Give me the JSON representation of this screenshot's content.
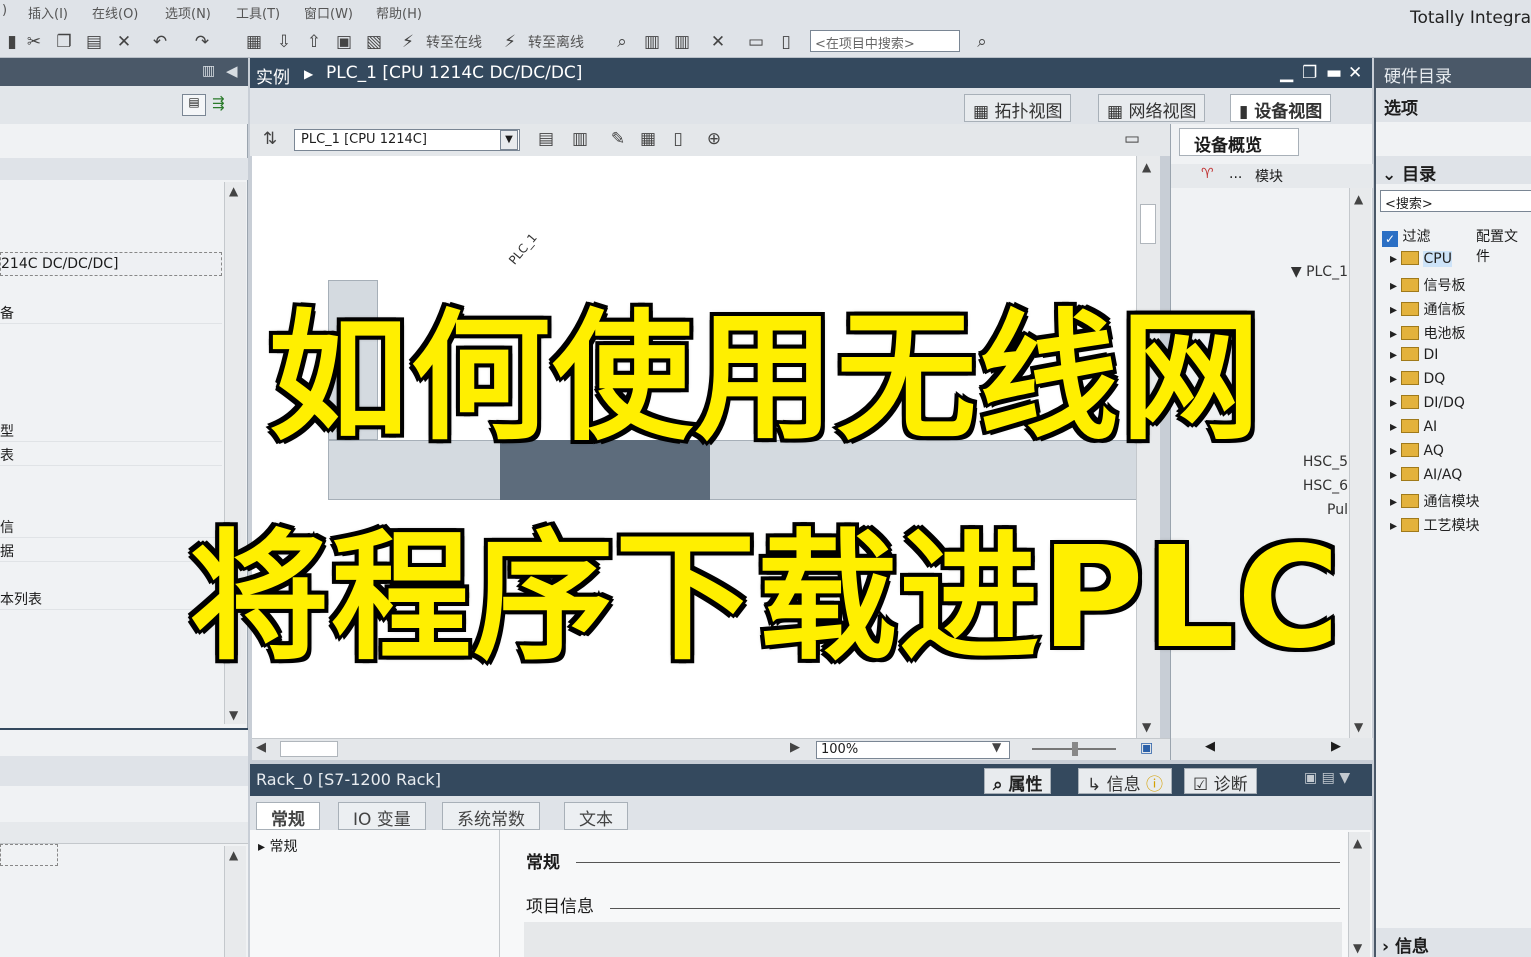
{
  "app": {
    "brand": "Totally Integra"
  },
  "menu": {
    "items": [
      ") ",
      "插入(I)",
      "在线(O)",
      "选项(N)",
      "工具(T)",
      "窗口(W)",
      "帮助(H)"
    ]
  },
  "toolbar": {
    "go_online": "转至在线",
    "go_offline": "转至离线",
    "search_placeholder": "<在项目中搜索>"
  },
  "left_panel": {
    "rows": [
      "214C DC/DC/DC]",
      "备",
      "",
      "型",
      "表",
      "信",
      "据",
      "本列表"
    ]
  },
  "editor": {
    "breadcrumb_root": "实例",
    "breadcrumb_device": "PLC_1 [CPU 1214C DC/DC/DC]",
    "view_tabs": [
      "拓扑视图",
      "网络视图",
      "设备视图"
    ],
    "device_select": "PLC_1 [CPU 1214C]",
    "plc_label": "PLC_1",
    "zoom": "100%"
  },
  "overview": {
    "tab": "设备概览",
    "col_module": "模块",
    "col_dots": "...",
    "rows": [
      "PLC_1",
      "HSC_5",
      "HSC_6",
      "Pul"
    ]
  },
  "catalog": {
    "title": "硬件目录",
    "options": "选项",
    "directory": "目录",
    "search_placeholder": "<搜索>",
    "filter_label": "过滤",
    "profile_label": "配置文件",
    "items": [
      "CPU",
      "信号板",
      "通信板",
      "电池板",
      "DI",
      "DQ",
      "DI/DQ",
      "AI",
      "AQ",
      "AI/AQ",
      "通信模块",
      "工艺模块"
    ],
    "info": "信息"
  },
  "properties": {
    "title": "Rack_0 [S7-1200 Rack]",
    "right_tabs": [
      "属性",
      "信息",
      "诊断"
    ],
    "tabs": [
      "常规",
      "IO 变量",
      "系统常数",
      "文本"
    ],
    "nav_item": "常规",
    "section_general": "常规",
    "section_project_info": "项目信息"
  },
  "overlay": {
    "line1": "如何使用无线网",
    "line2": "将程序下载进PLC"
  },
  "colors": {
    "headline": "#ffef00",
    "header_bar": "#34495e"
  }
}
